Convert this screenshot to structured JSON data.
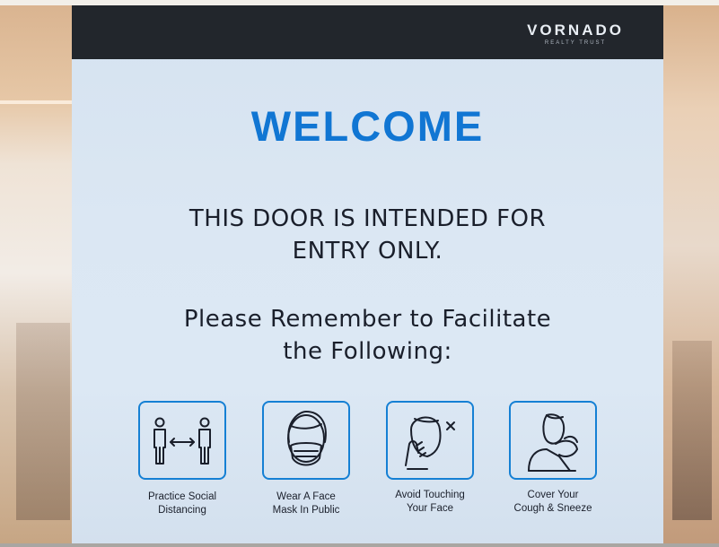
{
  "logo": {
    "main": "VORNADO",
    "sub": "REALTY TRUST"
  },
  "heading": "WELCOME",
  "entry_notice": {
    "line1": "THIS DOOR IS INTENDED FOR",
    "line2": "ENTRY ONLY."
  },
  "reminder": {
    "line1": "Please Remember to Facilitate",
    "line2": "the Following:"
  },
  "guidelines": [
    {
      "line1": "Practice Social",
      "line2": "Distancing",
      "icon": "social-distancing-icon"
    },
    {
      "line1": "Wear A Face",
      "line2": "Mask In Public",
      "icon": "face-mask-icon"
    },
    {
      "line1": "Avoid Touching",
      "line2": "Your Face",
      "icon": "no-touch-face-icon"
    },
    {
      "line1": "Cover Your",
      "line2": "Cough & Sneeze",
      "icon": "cover-cough-icon"
    }
  ],
  "colors": {
    "accent": "#1176d3",
    "header": "#22262c",
    "text": "#1a1f2b",
    "sign_bg": "#dbe7f3"
  }
}
